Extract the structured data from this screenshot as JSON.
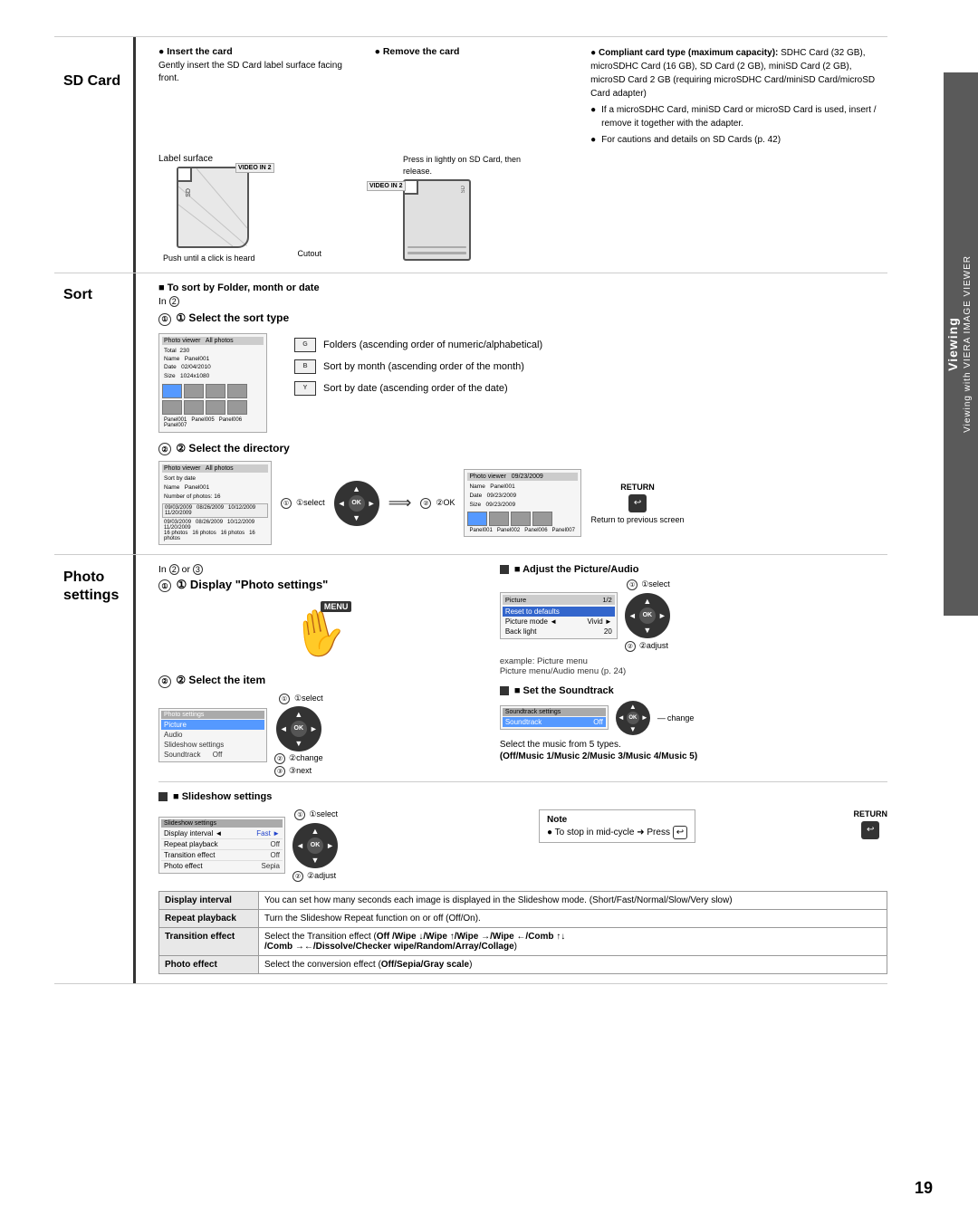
{
  "page": {
    "number": "19",
    "right_tab": {
      "line1": "Viewing",
      "line2": "Viewing with VIERA IMAGE VIEWER"
    }
  },
  "sections": {
    "sd_card": {
      "label": "SD Card",
      "insert_label": "● Insert the card",
      "insert_detail": "Gently insert the SD Card label surface facing front.",
      "remove_label": "● Remove the card",
      "compliant_header": "● Compliant card type (maximum capacity):",
      "compliant_items": [
        "SDHC Card (32 GB), microSDHC Card (16 GB), SD Card (2 GB), miniSD Card (2 GB), microSD Card 2 GB (requiring microSDHC Card/miniSD Card/microSD Card adapter)",
        "If a microSDHC Card, miniSD Card or microSD Card is used, insert / remove it together with the adapter.",
        "For cautions and details on SD Cards (p. 42)"
      ],
      "label_surface": "Label surface",
      "push_until": "Push until a click is heard",
      "cutout_label": "Cutout",
      "press_in": "Press in lightly on SD Card, then release.",
      "video_in_2": "VIDEO IN 2"
    },
    "sort": {
      "label": "Sort",
      "to_sort_title": "■ To sort by Folder, month or date",
      "in_step": "In ②",
      "step1_title": "① Select the sort type",
      "sort_types": [
        {
          "icon": "G",
          "text": "Folders (ascending order of numeric/alphabetical)"
        },
        {
          "icon": "B",
          "text": "Sort by month (ascending order of the month)"
        },
        {
          "icon": "Y",
          "text": "Sort by date (ascending order of the date)"
        }
      ],
      "step2_title": "② Select the directory",
      "step2_select": "①select",
      "step2_ok": "②OK",
      "return_label": "RETURN",
      "return_to": "Return to previous screen"
    },
    "photo_settings": {
      "label": "Photo settings",
      "in_step": "In ② or ③",
      "step1_title": "① Display \"Photo settings\"",
      "step2_title": "② Select the item",
      "step2_select": "①select",
      "step2_change": "②change",
      "step2_next": "③next",
      "settings_items": [
        "Photo settings",
        "Picture",
        "Audio",
        "Slideshow settings",
        "Soundtrack",
        "Off"
      ],
      "adjust_title": "■ Adjust the Picture/Audio",
      "adjust_page": "1/2",
      "adjust_select": "①select",
      "adjust_adjust": "②adjust",
      "adjust_items": [
        "Picture",
        "Reset to defaults",
        "Picture mode ◄ Vivid ►",
        "Back light   20"
      ],
      "adjust_example": "example: Picture menu",
      "adjust_note": "Picture menu/Audio menu (p. 24)",
      "soundtrack_title": "■ Set the Soundtrack",
      "soundtrack_label": "Soundtrack",
      "soundtrack_off": "Off",
      "soundtrack_change": "change",
      "soundtrack_desc": "Select the music from 5 types.",
      "soundtrack_options": "(Off/Music 1/Music 2/Music 3/Music 4/Music 5)",
      "slideshow_title": "■ Slideshow settings",
      "slideshow_items": [
        {
          "label": "Slideshow settings",
          "value": ""
        },
        {
          "label": "Display interval ◄",
          "value": "Fast ►"
        },
        {
          "label": "Repeat playback",
          "value": "Off"
        },
        {
          "label": "Transition effect",
          "value": "Off"
        },
        {
          "label": "Photo effect",
          "value": "Sepia"
        }
      ],
      "slideshow_select": "①select",
      "slideshow_adjust": "②adjust",
      "note_title": "Note",
      "note_text": "● To stop in mid-cycle ➜ Press ⏎",
      "table_rows": [
        {
          "label": "Display interval",
          "text": "You can set how many seconds each image is displayed in the Slideshow mode. (Short/Fast/Normal/Slow/Very slow)"
        },
        {
          "label": "Repeat playback",
          "text": "Turn the Slideshow Repeat function on or off (Off/On)."
        },
        {
          "label": "Transition effect",
          "text": "Select the Transition effect (Off /Wipe ↓/Wipe ↑/Wipe →/Wipe ←/Comb ↑↓/Comb →←/Dissolve/Checker wipe/Random/Array/Collage)"
        },
        {
          "label": "Photo effect",
          "text": "Select the conversion effect (Off/Sepia/Gray scale)"
        }
      ]
    }
  }
}
